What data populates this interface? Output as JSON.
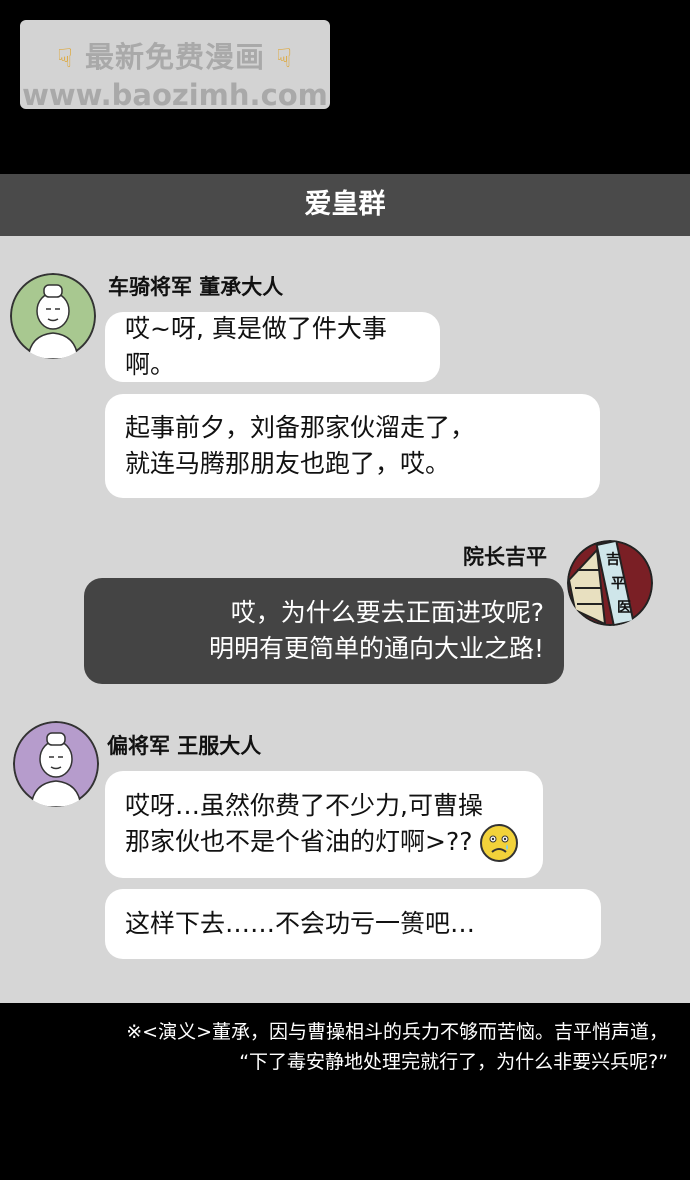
{
  "watermark": {
    "line1": "最新免费漫画",
    "line2": "www.baozimh.com"
  },
  "chat": {
    "title": "爱皇群",
    "messages": [
      {
        "sender": "车骑将军 董承大人",
        "avatar": "dong-cheng-avatar",
        "bubbles": [
          "哎~呀, 真是做了件大事啊。",
          "起事前夕，刘备那家伙溜走了，",
          "就连马腾那朋友也跑了，哎。"
        ]
      },
      {
        "sender": "院长吉平",
        "avatar": "ji-ping-avatar",
        "sign_text": [
          "吉",
          "平",
          "医"
        ],
        "bubbles": [
          "哎，为什么要去正面进攻呢?",
          "明明有更简单的通向大业之路!"
        ]
      },
      {
        "sender": "偏将军 王服大人",
        "avatar": "wang-fu-avatar",
        "bubbles": [
          "哎呀…虽然你费了不少力,可曹操",
          "那家伙也不是个省油的灯啊>??",
          "这样下去……不会功亏一篑吧…"
        ]
      }
    ]
  },
  "footnote": {
    "line1": "※<演义>董承，因与曹操相斗的兵力不够而苦恼。吉平悄声道，",
    "line2": "“下了毒安静地处理完就行了，为什么非要兴兵呢?”"
  },
  "colors": {
    "background": "#000000",
    "chat_bg": "#d6d6d6",
    "header_bg": "#4a4a4a",
    "dark_bubble": "#444444"
  }
}
